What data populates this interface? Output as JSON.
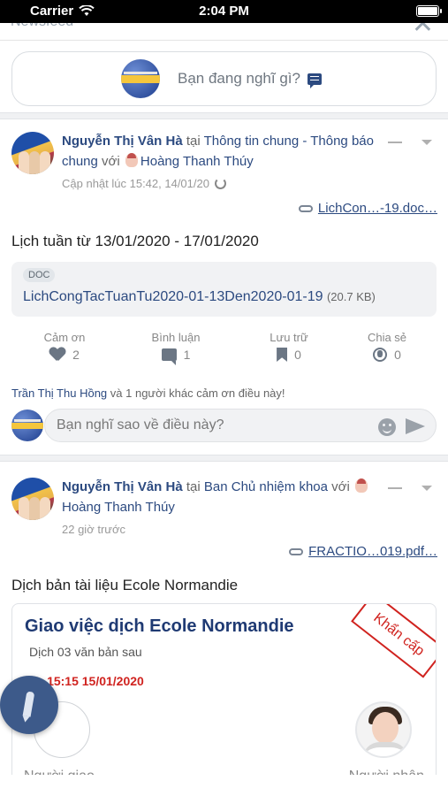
{
  "status_bar": {
    "carrier": "Carrier",
    "time": "2:04 PM"
  },
  "header": {
    "title": "Newsfeed"
  },
  "composer": {
    "placeholder": "Bạn đang nghĩ gì?"
  },
  "posts": [
    {
      "author": "Nguyễn Thị Vân Hà",
      "at_word": "tại",
      "group": "Thông tin chung - Thông báo chung",
      "with_word": "với",
      "tagged": "Hoàng Thanh Thúy",
      "meta": "Cập nhật lúc 15:42, 14/01/20",
      "attachment_link": "LichCon…-19.doc…",
      "title": "Lịch tuần từ 13/01/2020 - 17/01/2020",
      "doc": {
        "badge": "DOC",
        "name": "LichCongTacTuanTu2020-01-13Den2020-01-19",
        "size": "(20.7 KB)"
      },
      "actions": [
        {
          "label": "Cảm ơn",
          "count": "2",
          "icon": "heart-icon"
        },
        {
          "label": "Bình luận",
          "count": "1",
          "icon": "comment-icon"
        },
        {
          "label": "Lưu trữ",
          "count": "0",
          "icon": "bookmark-icon"
        },
        {
          "label": "Chia sẻ",
          "count": "0",
          "icon": "globe-icon"
        }
      ],
      "thanks_who": "Trần Thị Thu Hồng",
      "thanks_rest": "và 1 người khác cảm ơn điều này!",
      "comment_placeholder": "Bạn nghĩ sao về điều này?"
    },
    {
      "author": "Nguyễn Thị Vân Hà",
      "at_word": "tại",
      "group": "Ban Chủ nhiệm khoa",
      "with_word": "với",
      "tagged": "Hoàng Thanh Thúy",
      "meta": "22 giờ trước",
      "attachment_link": "FRACTIO…019.pdf…",
      "title": "Dịch bản tài liệu Ecole Normandie",
      "task": {
        "title": "Giao việc dịch Ecole Normandie",
        "subtitle": "Dịch 03 văn bản sau",
        "due": "~ 15:15 15/01/2020",
        "stamp": "Khẩn cấp",
        "assigner_label": "Người giao",
        "assignee_label": "Người nhận"
      }
    }
  ],
  "colors": {
    "primary": "#2c4a80",
    "urgent": "#d0231f",
    "fab": "#3d5a8a"
  }
}
